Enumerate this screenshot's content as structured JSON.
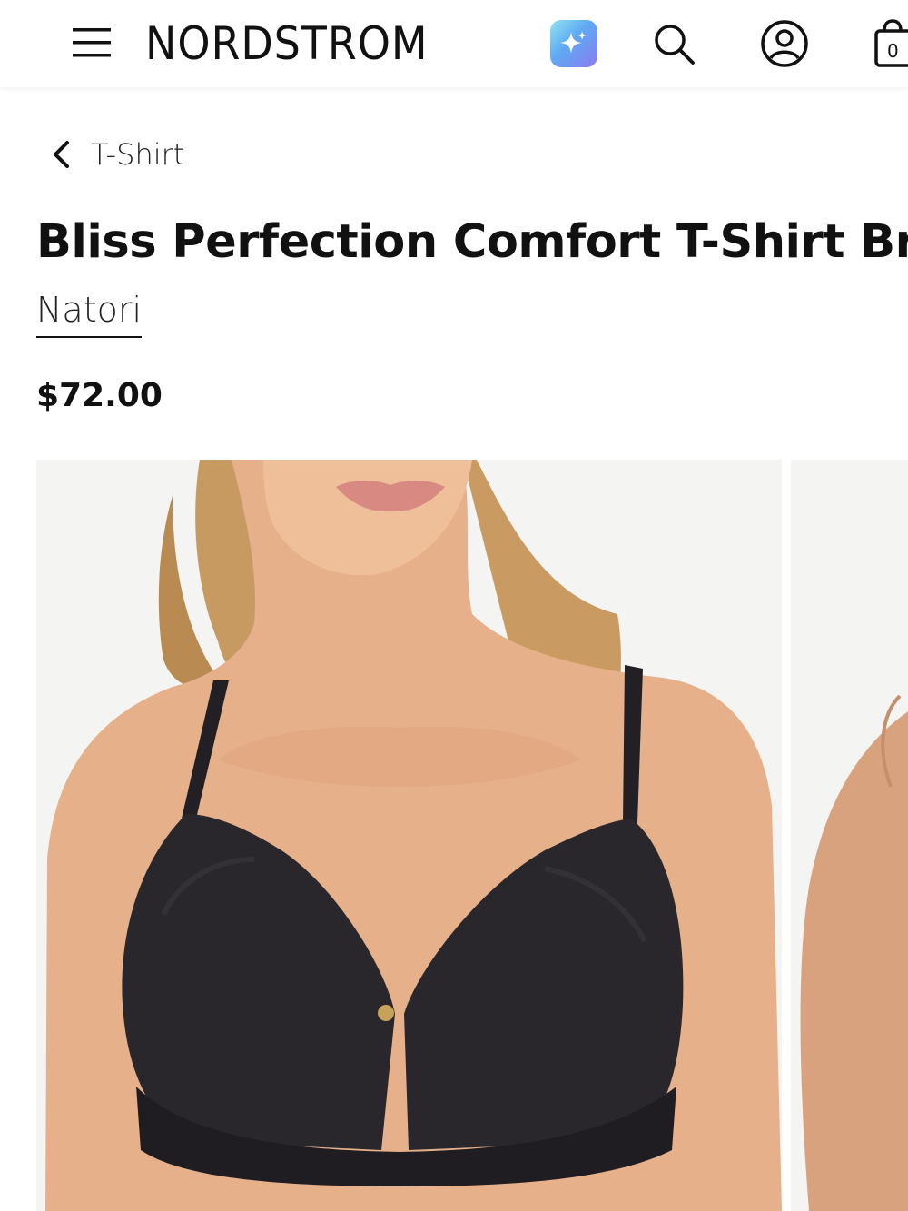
{
  "header": {
    "brand": "NORDSTROM",
    "icons": {
      "menu": "hamburger-menu-icon",
      "ai": "sparkle-icon",
      "search": "search-icon",
      "account": "account-icon",
      "bag": "shopping-bag-icon"
    },
    "bag_count": "0",
    "ai_gradient": [
      "#8ee3f0",
      "#5fa8f2",
      "#8a7bf0"
    ]
  },
  "breadcrumb": {
    "label": "T-Shirt",
    "icon": "chevron-left-icon"
  },
  "product": {
    "title": "Bliss Perfection Comfort T-Shirt Bra",
    "brand": "Natori",
    "price": "$72.00"
  },
  "gallery": {
    "images": [
      {
        "alt": "Model wearing black t-shirt bra, front view"
      },
      {
        "alt": "Model wearing black t-shirt bra, side view"
      }
    ]
  }
}
